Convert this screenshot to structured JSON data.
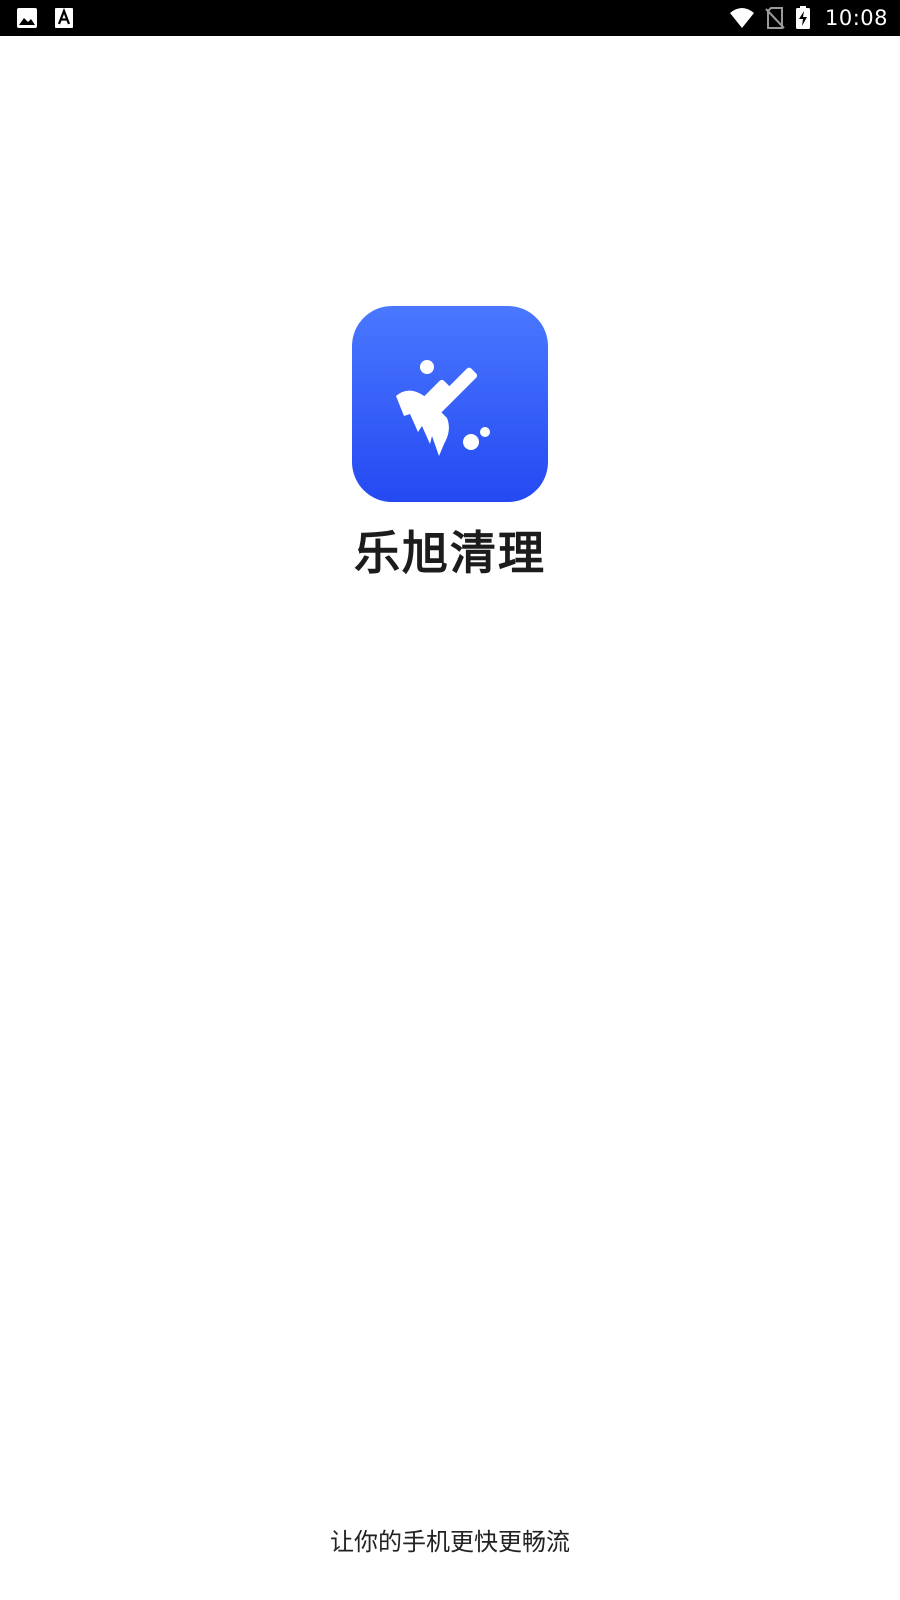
{
  "status_bar": {
    "left_icons": [
      "image-icon",
      "font-icon"
    ],
    "right_icons": [
      "wifi-icon",
      "no-sim-icon",
      "battery-charging-icon"
    ],
    "time": "10:08"
  },
  "splash": {
    "app_icon": "broom-icon",
    "app_name": "乐旭清理",
    "slogan": "让你的手机更快更畅流",
    "icon_gradient_top": "#4a78ff",
    "icon_gradient_bottom": "#2449f2"
  }
}
